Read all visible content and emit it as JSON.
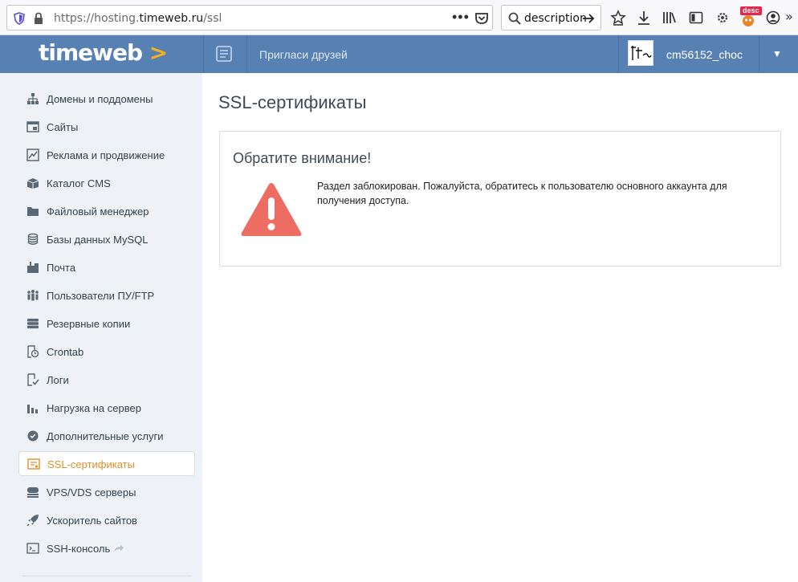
{
  "browser": {
    "url_prefix": "https://hosting.",
    "url_domain": "timeweb.ru",
    "url_path": "/ssl",
    "search_value": "description",
    "badge": "desc"
  },
  "header": {
    "logo": "timeweb",
    "invite": "Пригласи друзей",
    "username": "cm56152_choc"
  },
  "sidebar": {
    "items": [
      {
        "label": "Домены и поддомены",
        "icon": "sitemap-icon"
      },
      {
        "label": "Сайты",
        "icon": "browser-window-icon"
      },
      {
        "label": "Реклама и продвижение",
        "icon": "chart-line-icon"
      },
      {
        "label": "Каталог CMS",
        "icon": "box-icon"
      },
      {
        "label": "Файловый менеджер",
        "icon": "folder-icon"
      },
      {
        "label": "Базы данных MySQL",
        "icon": "database-icon"
      },
      {
        "label": "Почта",
        "icon": "mailbox-icon"
      },
      {
        "label": "Пользователи ПУ/FTP",
        "icon": "users-icon"
      },
      {
        "label": "Резервные копии",
        "icon": "server-stack-icon"
      },
      {
        "label": "Crontab",
        "icon": "clock-page-icon"
      },
      {
        "label": "Логи",
        "icon": "log-page-icon"
      },
      {
        "label": "Нагрузка на сервер",
        "icon": "bar-chart-icon"
      },
      {
        "label": "Дополнительные услуги",
        "icon": "gear-badge-icon"
      },
      {
        "label": "SSL-сертификаты",
        "icon": "certificate-icon"
      },
      {
        "label": "VPS/VDS серверы",
        "icon": "server-icon"
      },
      {
        "label": "Ускоритель сайтов",
        "icon": "rocket-icon"
      },
      {
        "label": "SSH-консоль",
        "icon": "terminal-icon"
      }
    ],
    "active_index": 13
  },
  "main": {
    "title": "SSL-сертификаты",
    "notice_title": "Обратите внимание!",
    "notice_text": "Раздел заблокирован. Пожалуйста, обратитесь к пользователю основного аккаунта для получения доступа."
  },
  "colors": {
    "header_bg": "#5780b3",
    "logo_accent": "#f3b11d",
    "sidebar_bg": "#eef2f6",
    "active_text": "#e0902a",
    "warning": "#ee6d63"
  }
}
